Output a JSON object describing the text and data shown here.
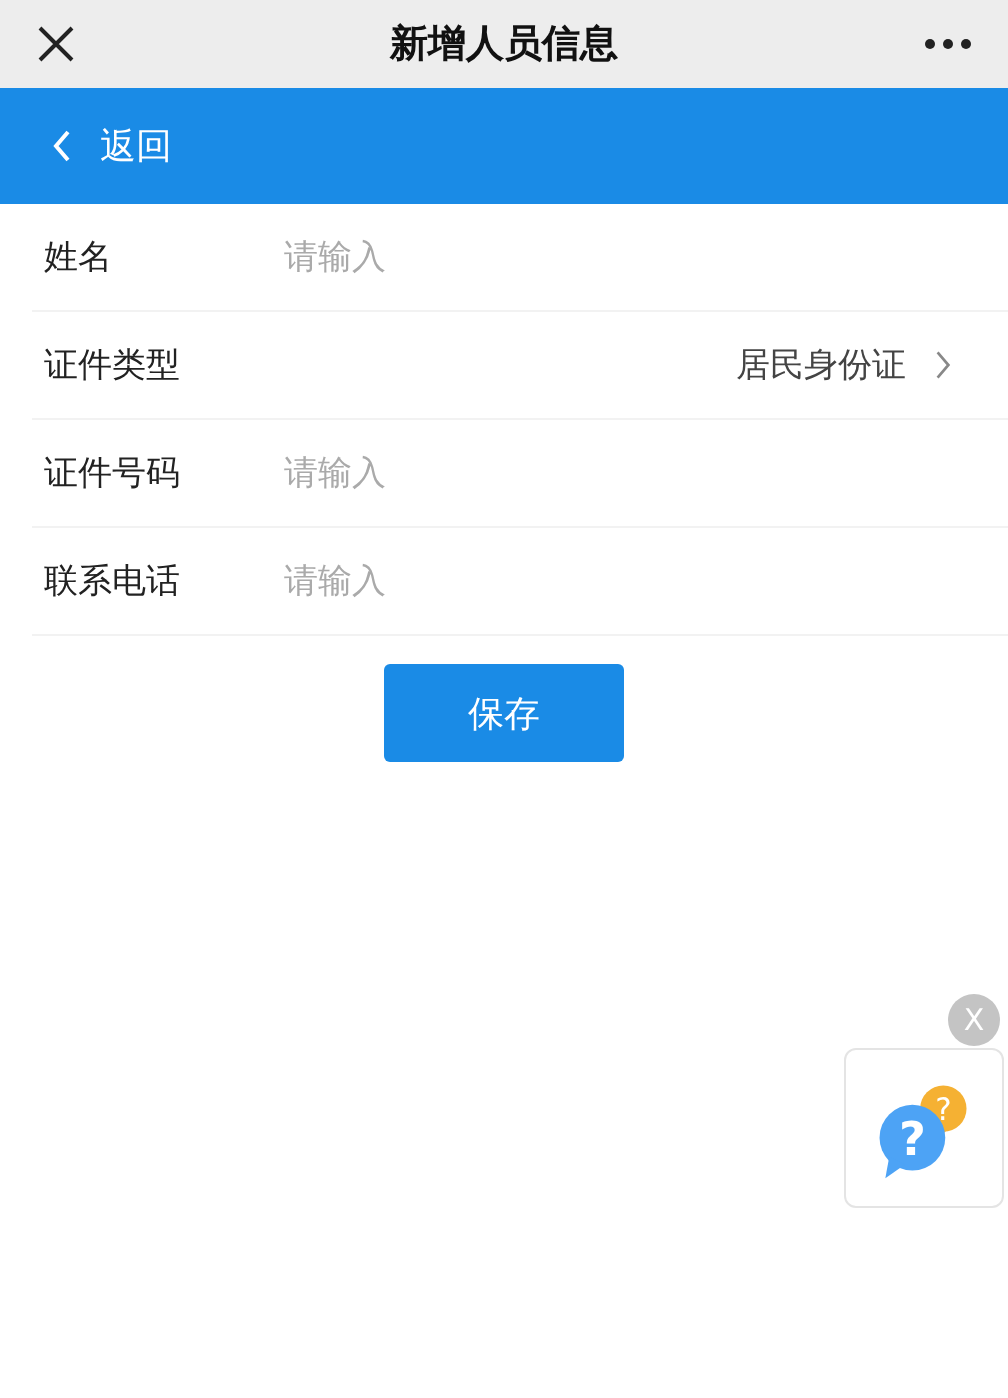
{
  "window": {
    "title": "新增人员信息"
  },
  "nav": {
    "back": "返回"
  },
  "fields": [
    {
      "kind": "input",
      "label": "姓名",
      "placeholder": "请输入"
    },
    {
      "kind": "select",
      "label": "证件类型",
      "value": "居民身份证"
    },
    {
      "kind": "input",
      "label": "证件号码",
      "placeholder": "请输入"
    },
    {
      "kind": "input",
      "label": "联系电话",
      "placeholder": "请输入"
    }
  ],
  "buttons": [
    "保存"
  ],
  "help_widget": {
    "close": "X",
    "marks": [
      "?",
      "?"
    ]
  }
}
